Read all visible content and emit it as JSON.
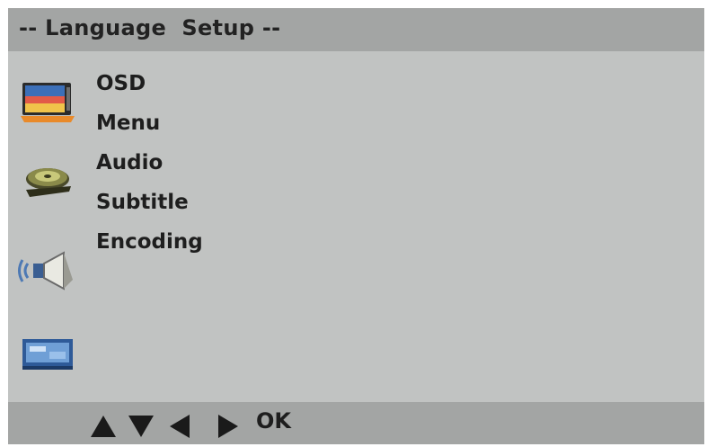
{
  "header": {
    "title": "-- Language  Setup --"
  },
  "sidebar": {
    "icons": [
      "display-setup-icon",
      "disc-setup-icon",
      "speaker-audio-icon",
      "video-card-icon"
    ]
  },
  "menu": {
    "items": [
      {
        "label": "OSD"
      },
      {
        "label": "Menu"
      },
      {
        "label": "Audio"
      },
      {
        "label": "Subtitle"
      },
      {
        "label": "Encoding"
      }
    ]
  },
  "footer": {
    "keys": [
      "up-arrow-icon",
      "down-arrow-icon",
      "left-arrow-icon",
      "right-arrow-icon"
    ],
    "ok_label": "OK"
  },
  "colors": {
    "screen_background": "#c1c3c2",
    "bar_background": "#a3a5a4",
    "text": "#1e1e1e"
  }
}
